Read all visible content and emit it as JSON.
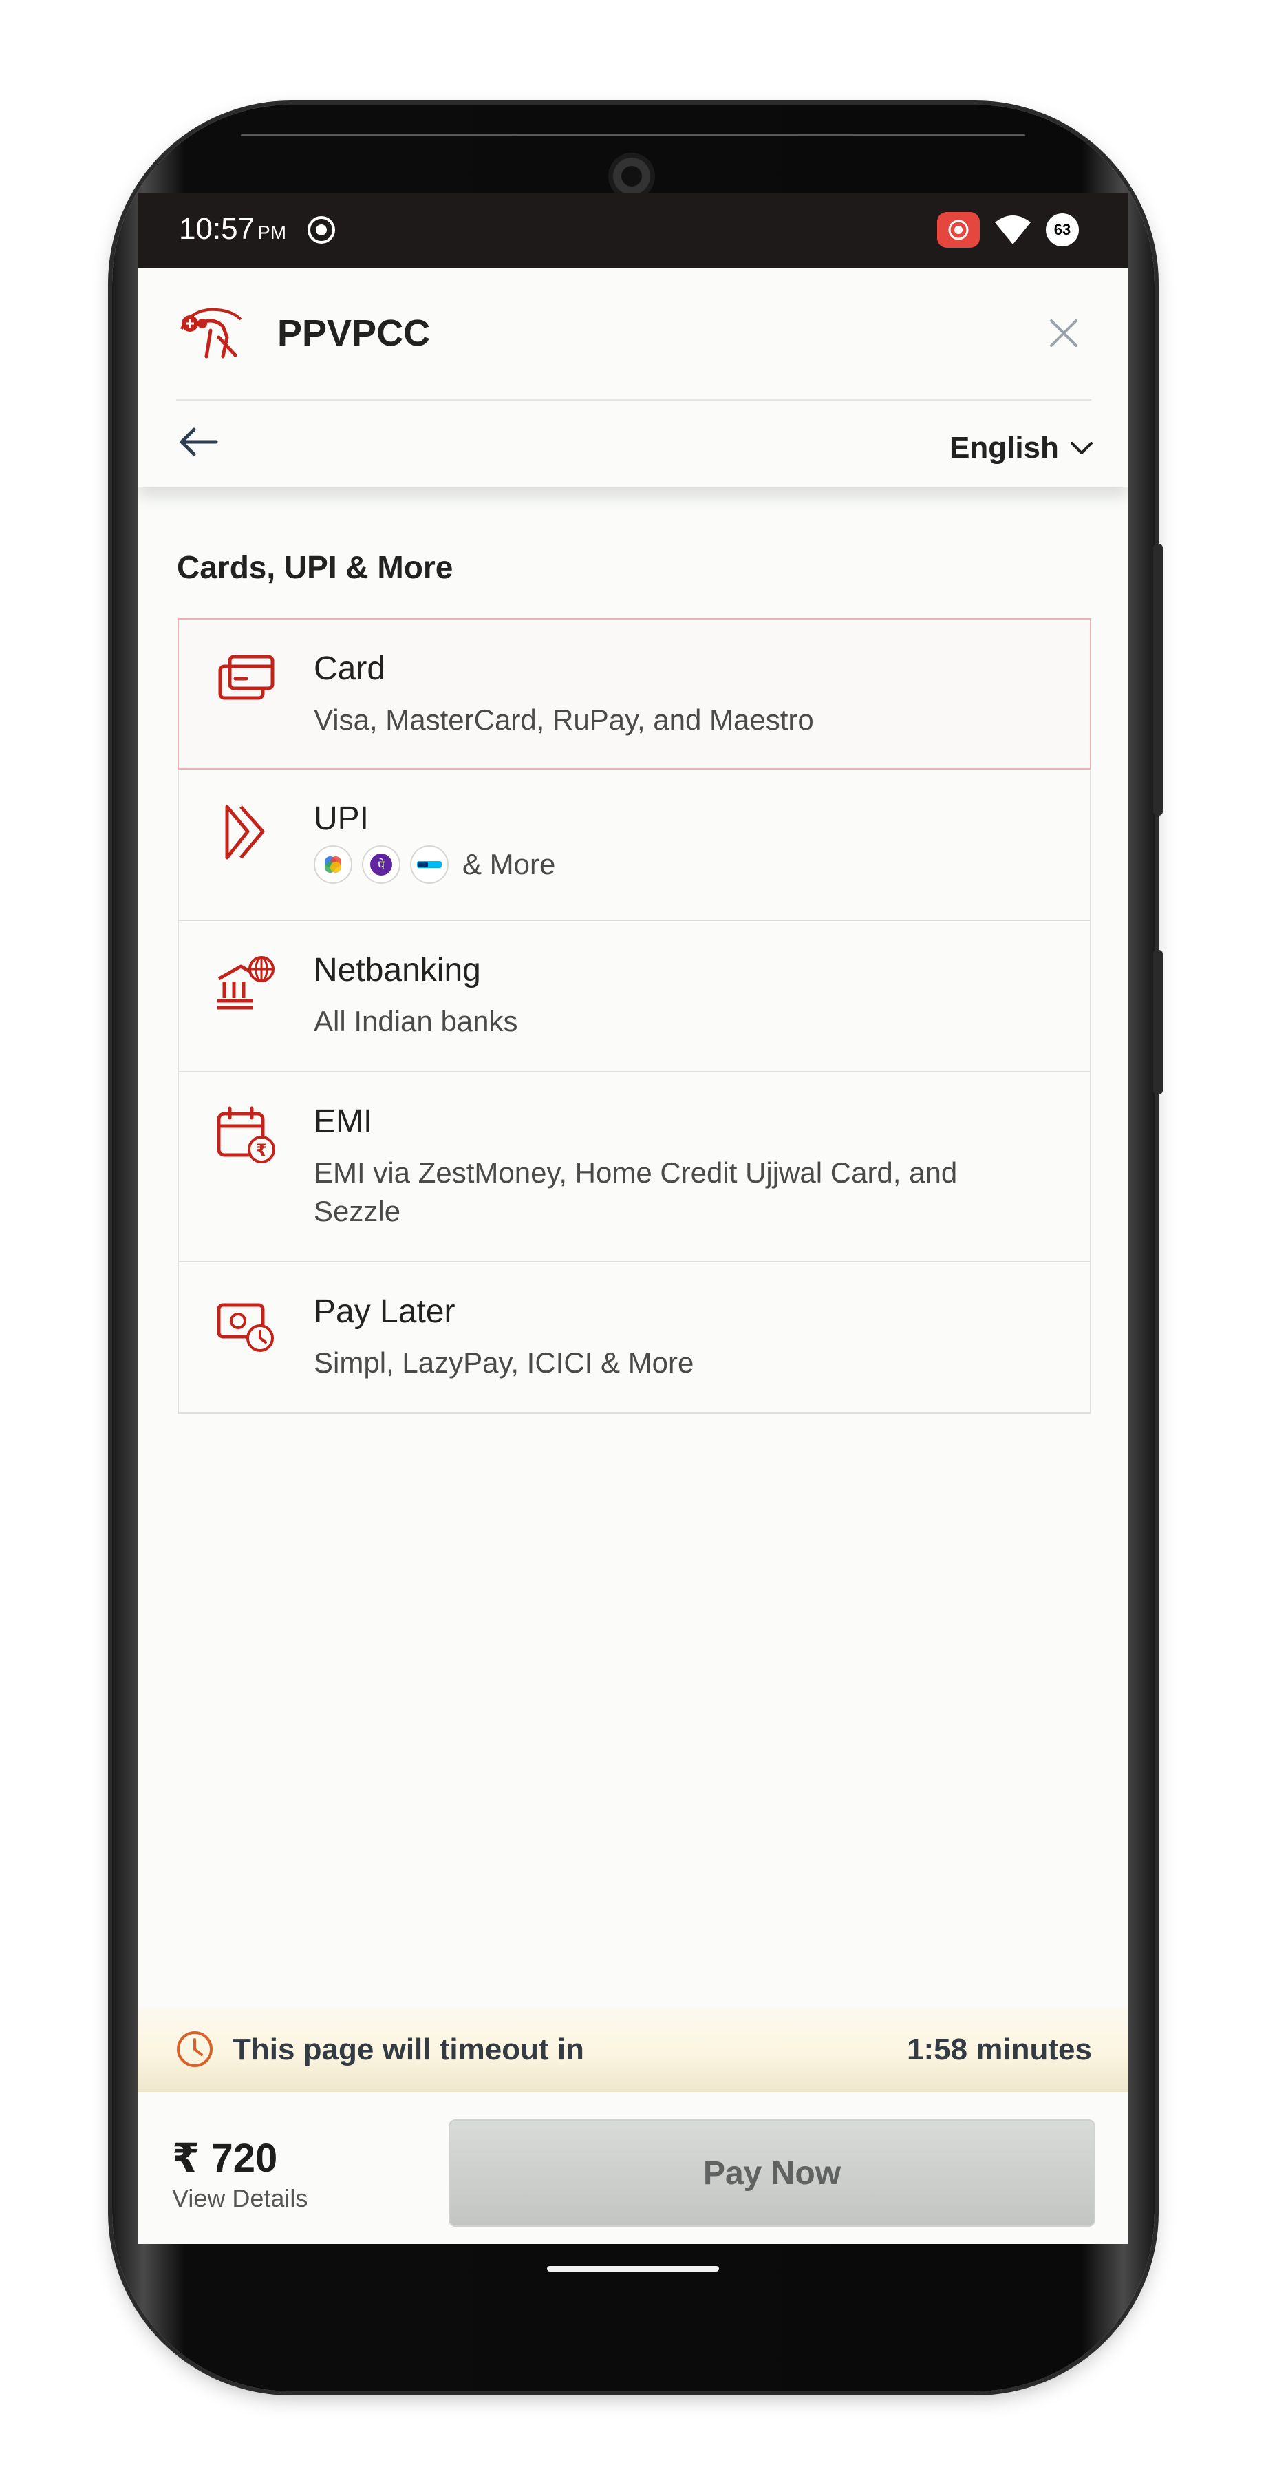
{
  "status_bar": {
    "time": "10:57",
    "ampm": "PM",
    "battery_level": "63",
    "icons": [
      "record-icon",
      "cast-icon",
      "wifi-icon",
      "battery-icon"
    ]
  },
  "header": {
    "merchant_name": "PPVPCC",
    "language": "English",
    "icons": [
      "merchant-logo",
      "close-icon",
      "back-arrow-icon",
      "chevron-down-icon"
    ]
  },
  "section_title": "Cards, UPI & More",
  "methods": [
    {
      "title": "Card",
      "description": "Visa, MasterCard, RuPay, and Maestro",
      "icon": "card-icon"
    },
    {
      "title": "UPI",
      "description": "& More",
      "icon": "upi-icon",
      "apps": [
        "google-pay-icon",
        "phonepe-icon",
        "paytm-icon"
      ]
    },
    {
      "title": "Netbanking",
      "description": "All Indian banks",
      "icon": "bank-icon"
    },
    {
      "title": "EMI",
      "description": "EMI via ZestMoney, Home Credit Ujjwal Card, and Sezzle",
      "icon": "emi-calendar-icon"
    },
    {
      "title": "Pay Later",
      "description": "Simpl, LazyPay, ICICI & More",
      "icon": "pay-later-icon"
    }
  ],
  "timeout": {
    "text": "This page will timeout in",
    "value": "1:58 minutes"
  },
  "footer": {
    "amount": "₹ 720",
    "view_details": "View Details",
    "pay_button": "Pay Now"
  },
  "colors": {
    "accent": "#c4231a",
    "pay_button": "#cfd1cf",
    "timeout_bg": "#fcf5e0"
  }
}
